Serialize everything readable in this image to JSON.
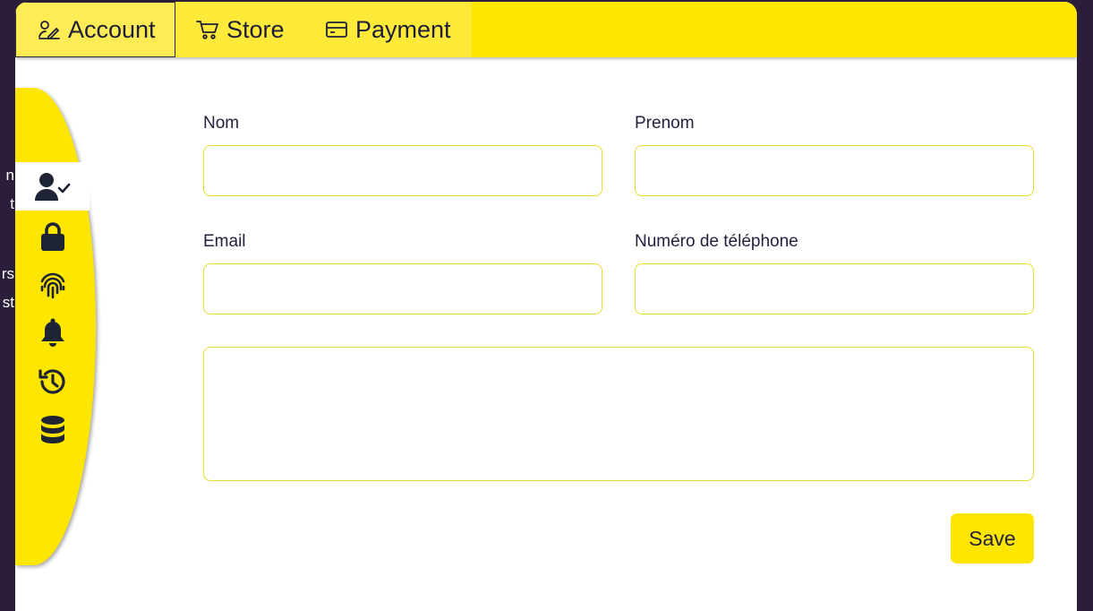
{
  "tabs": [
    {
      "label": "Account",
      "icon": "signature-icon",
      "active": true
    },
    {
      "label": "Store",
      "icon": "cart-icon",
      "active": false
    },
    {
      "label": "Payment",
      "icon": "credit-card-icon",
      "active": false
    }
  ],
  "sidebar": {
    "items": [
      {
        "icon": "user-check-icon",
        "active": true
      },
      {
        "icon": "lock-icon",
        "active": false
      },
      {
        "icon": "fingerprint-icon",
        "active": false
      },
      {
        "icon": "bell-icon",
        "active": false
      },
      {
        "icon": "history-icon",
        "active": false
      },
      {
        "icon": "database-icon",
        "active": false
      }
    ]
  },
  "background_peek": [
    "n",
    "t",
    "rs",
    "st"
  ],
  "form": {
    "nom_label": "Nom",
    "prenom_label": "Prenom",
    "email_label": "Email",
    "phone_label": "Numéro de téléphone",
    "nom_value": "",
    "prenom_value": "",
    "email_value": "",
    "phone_value": "",
    "message_value": "",
    "save_label": "Save"
  },
  "colors": {
    "accent": "#ffe600",
    "text": "#22223e",
    "field_border": "#e8dc2a",
    "backdrop": "#2a1e3a"
  }
}
